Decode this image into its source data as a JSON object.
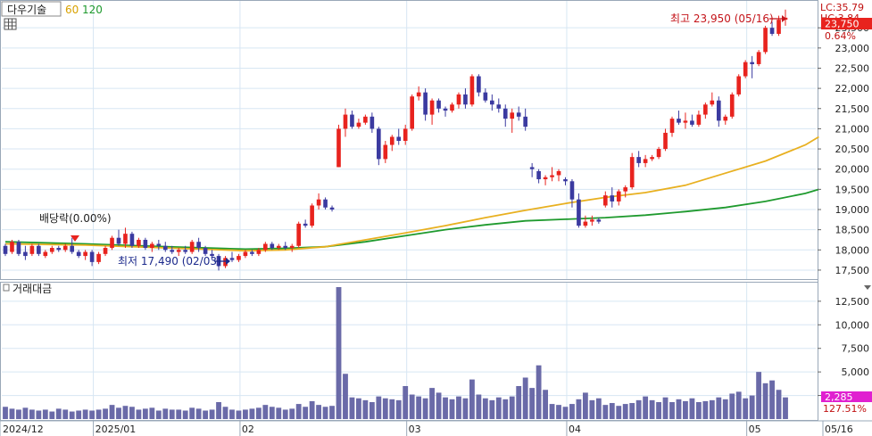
{
  "header": {
    "name": "다우기술",
    "ma60_label": "60",
    "ma120_label": "120",
    "lc_label": "LC:35.79",
    "hc_label": "HC:3.84"
  },
  "colors": {
    "up": "#e8231e",
    "down": "#3b3aa0",
    "ma60": "#e8b020",
    "ma120": "#1f9a2e",
    "volume": "#6a6aa8",
    "price_tag": "#e8231e",
    "volume_tag": "#e020d0",
    "grid": "#d7e6f3",
    "annotation_high": "#c4141a",
    "annotation_low": "#1c2a8c"
  },
  "annotations": {
    "high": "최고 23,950 (05/16)",
    "low": "최저 17,490 (02/03)",
    "dividend": "배당락(0.00%)"
  },
  "price_tags": {
    "current": "23,750",
    "change_pct": "0.64%"
  },
  "volume_panel": {
    "title": "거래대금",
    "current_tag": "2,285",
    "pct_tag": "127.51%"
  },
  "chart_data": {
    "type": "candlestick",
    "x_labels": [
      {
        "label": "2024/12",
        "index": 0
      },
      {
        "label": "2025/01",
        "index": 14
      },
      {
        "label": "02",
        "index": 36
      },
      {
        "label": "03",
        "index": 61
      },
      {
        "label": "04",
        "index": 85
      },
      {
        "label": "05",
        "index": 112
      },
      {
        "label": "05/16",
        "index": 122
      }
    ],
    "price_axis": {
      "min": 17300,
      "max": 24100,
      "ticks": [
        17500,
        18000,
        18500,
        19000,
        19500,
        20000,
        20500,
        21000,
        21500,
        22000,
        22500,
        23000,
        23500
      ]
    },
    "volume_axis": {
      "min": 0,
      "max": 14000,
      "ticks": [
        2500,
        5000,
        7500,
        10000,
        12500
      ]
    },
    "ohlc": [
      [
        18100,
        18150,
        17850,
        17900
      ],
      [
        17950,
        18250,
        17900,
        18200
      ],
      [
        18200,
        18250,
        17850,
        17900
      ],
      [
        17950,
        18100,
        17750,
        17850
      ],
      [
        17900,
        18150,
        17850,
        18100
      ],
      [
        18100,
        18150,
        17850,
        17900
      ],
      [
        17850,
        18000,
        17800,
        17950
      ],
      [
        17950,
        18100,
        17900,
        18050
      ],
      [
        18050,
        18100,
        17950,
        18000
      ],
      [
        18000,
        18150,
        17950,
        18100
      ],
      [
        18100,
        18300,
        17900,
        17950
      ],
      [
        17950,
        18000,
        17800,
        17850
      ],
      [
        17850,
        18000,
        17750,
        17950
      ],
      [
        17950,
        18000,
        17600,
        17700
      ],
      [
        17700,
        17950,
        17650,
        17900
      ],
      [
        17900,
        18100,
        17850,
        18050
      ],
      [
        18050,
        18350,
        18000,
        18300
      ],
      [
        18300,
        18500,
        18100,
        18150
      ],
      [
        18150,
        18550,
        18050,
        18400
      ],
      [
        18400,
        18450,
        18050,
        18100
      ],
      [
        18100,
        18300,
        18050,
        18250
      ],
      [
        18250,
        18300,
        18000,
        18050
      ],
      [
        18050,
        18200,
        17950,
        18150
      ],
      [
        18150,
        18250,
        18000,
        18100
      ],
      [
        18100,
        18200,
        17950,
        18000
      ],
      [
        18000,
        18100,
        17900,
        17950
      ],
      [
        17950,
        18050,
        17850,
        18000
      ],
      [
        18000,
        18100,
        17900,
        17950
      ],
      [
        17950,
        18250,
        17900,
        18200
      ],
      [
        18200,
        18300,
        17950,
        18050
      ],
      [
        18050,
        18100,
        17850,
        17900
      ],
      [
        17900,
        18000,
        17750,
        17850
      ],
      [
        17850,
        17900,
        17490,
        17600
      ],
      [
        17600,
        17850,
        17550,
        17800
      ],
      [
        17800,
        17950,
        17700,
        17750
      ],
      [
        17750,
        17900,
        17700,
        17850
      ],
      [
        17850,
        18000,
        17800,
        17950
      ],
      [
        17950,
        18000,
        17850,
        17900
      ],
      [
        17900,
        18050,
        17850,
        18000
      ],
      [
        18000,
        18200,
        17950,
        18150
      ],
      [
        18150,
        18200,
        18000,
        18050
      ],
      [
        18050,
        18150,
        18000,
        18100
      ],
      [
        18100,
        18200,
        18000,
        18050
      ],
      [
        18050,
        18150,
        17950,
        18100
      ],
      [
        18100,
        18700,
        18050,
        18650
      ],
      [
        18650,
        18750,
        18550,
        18600
      ],
      [
        18600,
        19150,
        18550,
        19100
      ],
      [
        19100,
        19400,
        19000,
        19250
      ],
      [
        19250,
        19300,
        19000,
        19050
      ],
      [
        19050,
        19100,
        18950,
        19000
      ],
      [
        20050,
        21100,
        20050,
        21000
      ],
      [
        21000,
        21500,
        20800,
        21350
      ],
      [
        21350,
        21450,
        21000,
        21050
      ],
      [
        21050,
        21250,
        21000,
        21150
      ],
      [
        21150,
        21350,
        21100,
        21300
      ],
      [
        21300,
        21400,
        20900,
        21000
      ],
      [
        21000,
        21050,
        20100,
        20250
      ],
      [
        20250,
        20700,
        20150,
        20600
      ],
      [
        20600,
        20850,
        20450,
        20800
      ],
      [
        20800,
        21000,
        20600,
        20700
      ],
      [
        20700,
        21100,
        20600,
        21000
      ],
      [
        21000,
        21850,
        20950,
        21800
      ],
      [
        21800,
        22050,
        21700,
        21900
      ],
      [
        21900,
        22000,
        21200,
        21350
      ],
      [
        21350,
        21750,
        21100,
        21700
      ],
      [
        21700,
        21750,
        21400,
        21500
      ],
      [
        21500,
        21550,
        21300,
        21450
      ],
      [
        21450,
        21650,
        21400,
        21600
      ],
      [
        21600,
        21900,
        21500,
        21850
      ],
      [
        21850,
        22000,
        21500,
        21600
      ],
      [
        21600,
        22350,
        21550,
        22300
      ],
      [
        22300,
        22350,
        21800,
        21900
      ],
      [
        21900,
        22000,
        21650,
        21700
      ],
      [
        21700,
        21850,
        21450,
        21600
      ],
      [
        21600,
        21750,
        21400,
        21500
      ],
      [
        21500,
        21600,
        21050,
        21250
      ],
      [
        21250,
        21500,
        20900,
        21400
      ],
      [
        21400,
        21550,
        21200,
        21300
      ],
      [
        21300,
        21500,
        20950,
        21050
      ],
      [
        20050,
        20150,
        19800,
        20000
      ],
      [
        19950,
        20000,
        19650,
        19750
      ],
      [
        19750,
        19850,
        19600,
        19800
      ],
      [
        19800,
        20050,
        19700,
        19850
      ],
      [
        19850,
        20000,
        19700,
        19950
      ],
      [
        19750,
        19800,
        19600,
        19700
      ],
      [
        19700,
        19750,
        19050,
        19250
      ],
      [
        19250,
        19400,
        18550,
        18600
      ],
      [
        18600,
        18850,
        18550,
        18700
      ],
      [
        18700,
        18850,
        18600,
        18750
      ],
      [
        18750,
        18800,
        18650,
        18700
      ],
      [
        19100,
        19450,
        19050,
        19350
      ],
      [
        19350,
        19550,
        19050,
        19200
      ],
      [
        19200,
        19500,
        19100,
        19450
      ],
      [
        19450,
        19600,
        19300,
        19550
      ],
      [
        19550,
        20400,
        19500,
        20300
      ],
      [
        20300,
        20450,
        20050,
        20150
      ],
      [
        20150,
        20350,
        20050,
        20250
      ],
      [
        20250,
        20350,
        20200,
        20300
      ],
      [
        20300,
        20550,
        20250,
        20500
      ],
      [
        20500,
        21000,
        20450,
        20900
      ],
      [
        20900,
        21300,
        20800,
        21250
      ],
      [
        21250,
        21450,
        21100,
        21150
      ],
      [
        21150,
        21400,
        21000,
        21200
      ],
      [
        21200,
        21350,
        21050,
        21100
      ],
      [
        21100,
        21450,
        21050,
        21350
      ],
      [
        21350,
        21650,
        21250,
        21600
      ],
      [
        21600,
        21900,
        21550,
        21700
      ],
      [
        21700,
        21800,
        21050,
        21200
      ],
      [
        21200,
        21350,
        21100,
        21300
      ],
      [
        21300,
        21900,
        21250,
        21850
      ],
      [
        21850,
        22350,
        21800,
        22300
      ],
      [
        22300,
        22700,
        22250,
        22650
      ],
      [
        22650,
        22800,
        22250,
        22600
      ],
      [
        22600,
        22950,
        22550,
        22900
      ],
      [
        22900,
        23550,
        22850,
        23500
      ],
      [
        23500,
        23650,
        23300,
        23350
      ],
      [
        23350,
        23800,
        23300,
        23700
      ],
      [
        23700,
        23950,
        23550,
        23750
      ]
    ],
    "ma60": [
      [
        0,
        18150
      ],
      [
        12,
        18120
      ],
      [
        24,
        18050
      ],
      [
        36,
        17980
      ],
      [
        42,
        18000
      ],
      [
        48,
        18080
      ],
      [
        54,
        18250
      ],
      [
        60,
        18420
      ],
      [
        66,
        18600
      ],
      [
        72,
        18800
      ],
      [
        78,
        18980
      ],
      [
        84,
        19150
      ],
      [
        90,
        19300
      ],
      [
        96,
        19420
      ],
      [
        102,
        19600
      ],
      [
        108,
        19900
      ],
      [
        114,
        20200
      ],
      [
        120,
        20600
      ],
      [
        122,
        20800
      ]
    ],
    "ma120": [
      [
        0,
        18200
      ],
      [
        12,
        18150
      ],
      [
        24,
        18080
      ],
      [
        36,
        18020
      ],
      [
        42,
        18040
      ],
      [
        48,
        18080
      ],
      [
        54,
        18200
      ],
      [
        60,
        18350
      ],
      [
        66,
        18500
      ],
      [
        72,
        18620
      ],
      [
        78,
        18720
      ],
      [
        84,
        18760
      ],
      [
        90,
        18800
      ],
      [
        96,
        18860
      ],
      [
        102,
        18950
      ],
      [
        108,
        19050
      ],
      [
        114,
        19200
      ],
      [
        120,
        19400
      ],
      [
        122,
        19500
      ]
    ],
    "volume": [
      1300,
      1100,
      1000,
      1200,
      1000,
      900,
      1000,
      800,
      1100,
      1000,
      800,
      900,
      1000,
      900,
      1000,
      1100,
      1500,
      1200,
      1400,
      1300,
      1000,
      1100,
      1200,
      900,
      1100,
      1000,
      1000,
      900,
      1200,
      1100,
      900,
      1000,
      1800,
      1300,
      1000,
      900,
      1000,
      1100,
      1200,
      1500,
      1300,
      1200,
      1000,
      1100,
      1600,
      1300,
      1900,
      1500,
      1300,
      1400,
      14000,
      4800,
      2300,
      2200,
      2000,
      1800,
      2400,
      2200,
      2100,
      2000,
      3500,
      2600,
      2400,
      2200,
      3300,
      2800,
      2300,
      2100,
      2400,
      2200,
      4200,
      2600,
      2200,
      2000,
      2300,
      2100,
      2400,
      3500,
      4400,
      3300,
      5700,
      3100,
      1600,
      1500,
      1300,
      1600,
      2100,
      2800,
      2000,
      2200,
      1500,
      1700,
      1400,
      1600,
      1700,
      2000,
      2400,
      2000,
      1800,
      2300,
      1800,
      2100,
      1900,
      2200,
      1800,
      1900,
      2000,
      2300,
      2100,
      2700,
      2900,
      2200,
      2500,
      5000,
      3800,
      4100,
      3100,
      2300,
      2200,
      2600
    ]
  }
}
